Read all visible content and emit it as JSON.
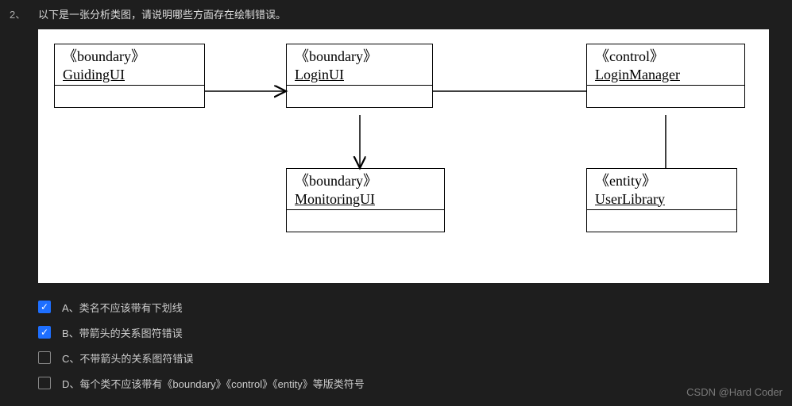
{
  "question": {
    "number": "2、",
    "text": "以下是一张分析类图，请说明哪些方面存在绘制错误。"
  },
  "diagram": {
    "classes": [
      {
        "stereotype": "《boundary》",
        "name": "GuidingUI"
      },
      {
        "stereotype": "《boundary》",
        "name": "LoginUI"
      },
      {
        "stereotype": "《control》",
        "name": "LoginManager"
      },
      {
        "stereotype": "《boundary》",
        "name": "MonitoringUI"
      },
      {
        "stereotype": "《entity》",
        "name": "UserLibrary"
      }
    ]
  },
  "options": [
    {
      "key": "A",
      "label": "A、类名不应该带有下划线",
      "checked": true
    },
    {
      "key": "B",
      "label": "B、带箭头的关系图符错误",
      "checked": true
    },
    {
      "key": "C",
      "label": "C、不带箭头的关系图符错误",
      "checked": false
    },
    {
      "key": "D",
      "label": "D、每个类不应该带有《boundary》《control》《entity》等版类符号",
      "checked": false
    }
  ],
  "watermark": "CSDN @Hard Coder",
  "glyphs": {
    "check": "✓"
  }
}
